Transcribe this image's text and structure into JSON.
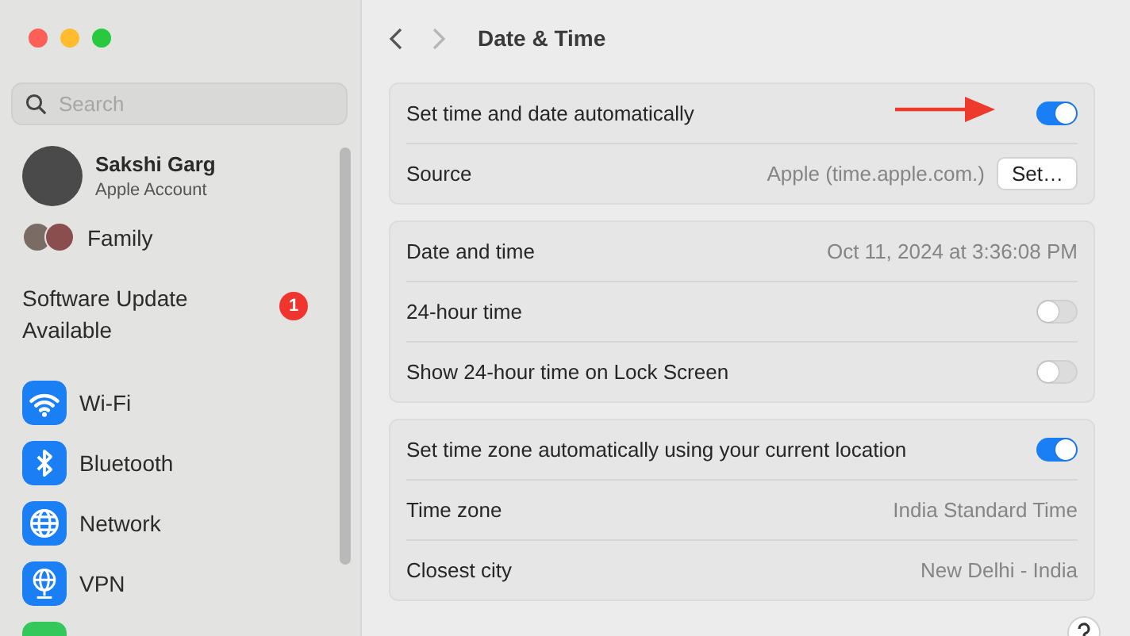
{
  "window": {
    "title": "Date & Time"
  },
  "sidebar": {
    "search": {
      "placeholder": "Search"
    },
    "items": [
      {
        "kind": "account",
        "name": "Sakshi Garg",
        "subtitle": "Apple Account"
      },
      {
        "kind": "family",
        "label": "Family"
      },
      {
        "kind": "update",
        "label": "Software Update Available",
        "badge": "1"
      },
      {
        "kind": "nav",
        "label": "Wi-Fi",
        "color": "#1a7ff5"
      },
      {
        "kind": "nav",
        "label": "Bluetooth",
        "color": "#1a7ff5"
      },
      {
        "kind": "nav",
        "label": "Network",
        "color": "#1a7ff5"
      },
      {
        "kind": "nav",
        "label": "VPN",
        "color": "#1a7ff5"
      },
      {
        "kind": "nav",
        "color": "#34c759"
      }
    ]
  },
  "groups": [
    {
      "rows": [
        {
          "kind": "toggle",
          "label": "Set time and date automatically",
          "on": true,
          "annotated": true
        },
        {
          "kind": "value_button",
          "label": "Source",
          "value": "Apple (time.apple.com.)",
          "button": "Set…"
        }
      ]
    },
    {
      "rows": [
        {
          "kind": "value",
          "label": "Date and time",
          "value": "Oct 11, 2024 at 3:36:08 PM"
        },
        {
          "kind": "toggle",
          "label": "24-hour time",
          "on": false
        },
        {
          "kind": "toggle",
          "label": "Show 24-hour time on Lock Screen",
          "on": false
        }
      ]
    },
    {
      "rows": [
        {
          "kind": "toggle",
          "label": "Set time zone automatically using your current location",
          "on": true
        },
        {
          "kind": "value",
          "label": "Time zone",
          "value": "India Standard Time"
        },
        {
          "kind": "value",
          "label": "Closest city",
          "value": "New Delhi - India"
        }
      ]
    }
  ]
}
